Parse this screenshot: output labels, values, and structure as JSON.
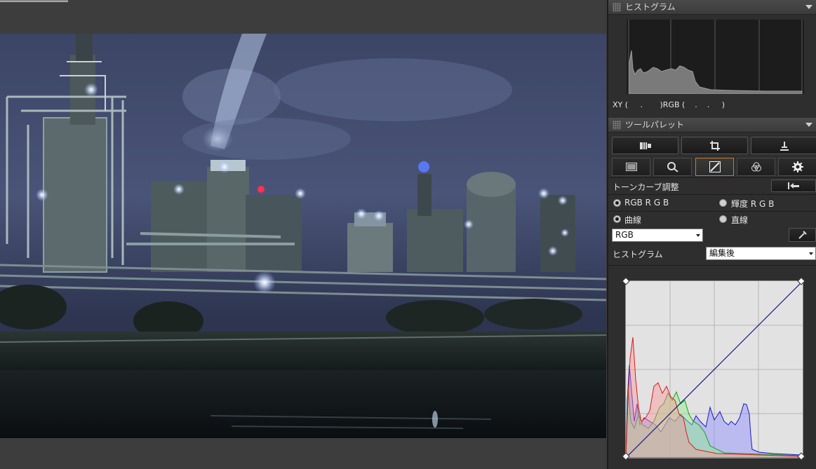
{
  "histogram_palette": {
    "title": "ヒストグラム",
    "xy_readout": "XY (     .       )RGB (    .    .     )"
  },
  "tool_palette": {
    "title": "ツールパレット",
    "top_buttons": [
      {
        "icon": "basic-adjust-icon"
      },
      {
        "icon": "crop-icon"
      },
      {
        "icon": "stamp-icon"
      }
    ],
    "tabs": [
      {
        "icon": "basic-image-adjust-icon",
        "active": false
      },
      {
        "icon": "nr-lens-icon",
        "active": false
      },
      {
        "icon": "tone-curve-icon",
        "active": true
      },
      {
        "icon": "color-adjust-icon",
        "active": false
      },
      {
        "icon": "settings-gear-icon",
        "active": false
      }
    ],
    "tone_curve": {
      "title": "トーンカーブ調整",
      "mode_rgb_label": "RGB R G B",
      "mode_luminance_label": "輝度 R G B",
      "curve_label": "曲線",
      "linear_label": "直線",
      "channel_value": "RGB",
      "histogram_label": "ヒストグラム",
      "histogram_value": "編集後",
      "selected_mode": "RGB R G B",
      "selected_curve": "曲線"
    }
  },
  "colors": {
    "panel_bg": "#2e2e2e",
    "active_tab_border": "#d07a1e",
    "red_channel": "#e0191d",
    "green_channel": "#1f9c1f",
    "blue_channel": "#1a1acc"
  }
}
